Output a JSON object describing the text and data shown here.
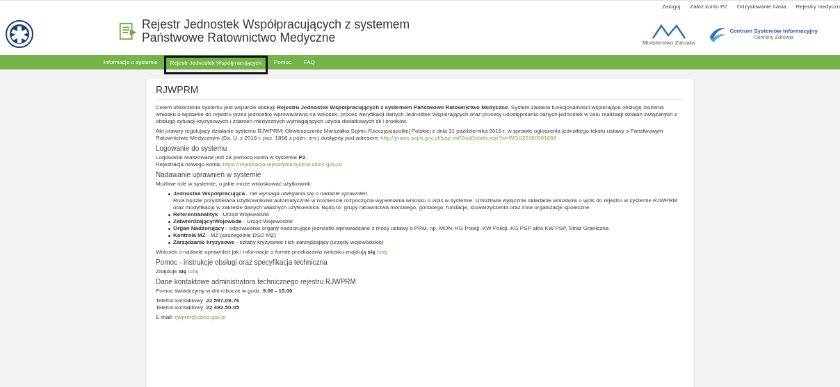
{
  "top_links": [
    "Zaloguj",
    "Załóż konto P2",
    "Odzyskiwanie hasła",
    "Rejestry medyczn"
  ],
  "header": {
    "title": "Rejestr Jednostek Współpracujących z systemem Państwowe Ratownictwo Medyczne",
    "ministry_caption": "Ministerstwo Zdrowia",
    "centre_name": "Centrum Systemów Informacyjny",
    "centre_subtitle": "Ochrony Zdrowia"
  },
  "nav": [
    {
      "label": "Informacje o systemie",
      "selected": false
    },
    {
      "label": "Rejestr Jednostek Współpracujących",
      "selected": true
    },
    {
      "label": "Pomoc",
      "selected": false
    },
    {
      "label": "FAQ",
      "selected": false
    }
  ],
  "page_title": "RJWPRM",
  "blocks": [
    {
      "kind": "para",
      "parts": [
        {
          "kind": "text",
          "text": "Celem utworzenia systemu jest wsparcie obsługi **Rejestru Jednostek Współpracujących z systemem Państwowe Ratownictwo Medyczne**. System zawiera funkcjonalności wspierające obsługę złożenia wniosku o wpisanie do rejestru przez jednostkę wprowadzaną na wniosek, proces weryfikacji danych Jednostek Wspierających oraz procesy udostępniania danych jednostek w celu realizacji działań związanych z obsługą sytuacji kryzysowych i zdarzeń medycznych wymagających użycia dodatkowych sił i środków."
        }
      ]
    },
    {
      "kind": "para",
      "parts": [
        {
          "kind": "text",
          "text": "Akt prawny regulujący działanie systemu RJWPRM: Obwieszczenie Marszałka Sejmu Rzeczypospolitej Polskiej z dnia 31 października 2016 r. w sprawie ogłoszenia jednolitego tekstu ustawy o Państwowym Ratownictwie Medycznym (Dz. U. z 2016 r. poz. 1868 z późn. zm.) dostępny pod adresem:"
        },
        {
          "kind": "link",
          "text": "http://prawo.sejm.gov.pl/isap.nsf/DocDetails.xsp?id=WDU20160001868"
        }
      ]
    },
    {
      "kind": "heading",
      "text": "Logowanie do systemu"
    },
    {
      "kind": "para",
      "parts": [
        {
          "kind": "text",
          "text": "Logowanie realizowane jest za pomocą konta w systemie **P2**."
        },
        {
          "kind": "break"
        },
        {
          "kind": "text",
          "text": "Rejestracja nowego konta:"
        },
        {
          "kind": "link",
          "text": "https://rejestracja.rejestrymedyczne.csioz.gov.pl/"
        }
      ]
    },
    {
      "kind": "heading",
      "text": "Nadawanie uprawnień w systemie"
    },
    {
      "kind": "para",
      "parts": [
        {
          "kind": "text",
          "text": "Możliwe role w systemie, o jakie może wnioskować użytkownik:"
        }
      ]
    },
    {
      "kind": "list",
      "items": [
        {
          "text": "**Jednostka Współpracująca** - *nie wymaga ubiegania się o nadanie uprawnień*.",
          "note": "Rola będzie przydzielana użytkownikowi automatycznie w momencie rozpoczęcia wypełniania wniosku o wpis w systemie. Umożliwia wyłącznie składanie wniosków o wpis do rejestru w systemie RJWPRM oraz modyfikację w zakresie danych własnych użytkownika. Będą to: grupy ratownictwa morskiego, górskiego, fundacje, stowarzyszenia oraz inne organizacje społeczne."
        },
        {
          "text": "**Referent/analityk** - Urząd Wojewódzki"
        },
        {
          "text": "**Zatwierdzający/Wojewoda** - Urząd Wojewódzki"
        },
        {
          "text": "**Organ Nadzorujący** - odpowiednie organy nadzorujące jednostki wprowadzane z mocy ustawy o PRM, np. MON, KG Policji, KW Policji, KG PSP albo KW PSP, Straż Graniczna"
        },
        {
          "text": "**Kontrola MZ** - MZ (szczególnie DSO MZ)"
        },
        {
          "text": "**Zarządzanie kryzysowe** - sztaby kryzysowe i ich zarządzający (urzędy wojewódzkie)"
        }
      ]
    },
    {
      "kind": "para",
      "parts": [
        {
          "kind": "text",
          "text": "Wniosek o nadanie uprawnień jak i informacje o formie przekazania wniosku znajdują **się**"
        },
        {
          "kind": "link",
          "text": "tutaj"
        }
      ]
    },
    {
      "kind": "heading",
      "text": "Pomoc - instrukcje obsługi oraz specyfikacja techniczna"
    },
    {
      "kind": "para",
      "parts": [
        {
          "kind": "text",
          "text": "Znajduje **się**"
        },
        {
          "kind": "link",
          "text": "tutaj"
        }
      ]
    },
    {
      "kind": "heading",
      "text": "Dane kontaktowe administratora technicznego rejestru RJWPRM"
    },
    {
      "kind": "para",
      "parts": [
        {
          "kind": "text",
          "text": "Pomoc świadczymy w dni robocze w godz. **9.00 - 15.00**."
        }
      ]
    },
    {
      "kind": "para",
      "parts": [
        {
          "kind": "text",
          "text": "Telefon kontaktowy: **22 597-09-76**"
        },
        {
          "kind": "break"
        },
        {
          "kind": "text",
          "text": "Telefon kontaktowy: **22 492-50-05**"
        }
      ]
    },
    {
      "kind": "para",
      "parts": [
        {
          "kind": "text",
          "text": "E-mail:"
        },
        {
          "kind": "link",
          "text": "rjwprm@csioz.gov.pl"
        }
      ]
    }
  ]
}
